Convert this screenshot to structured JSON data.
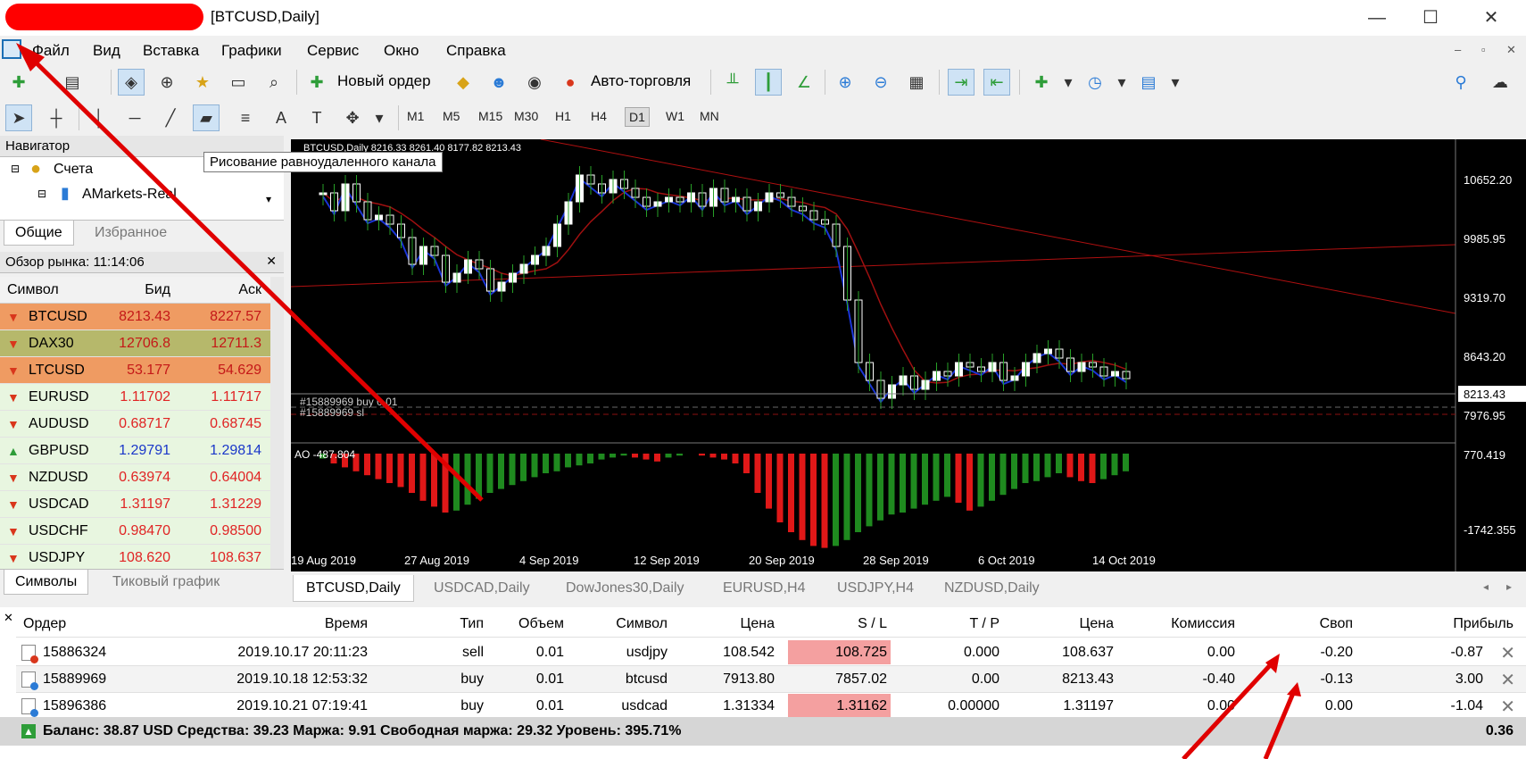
{
  "window": {
    "title": "[BTCUSD,Daily]",
    "minimize_glyph": "—",
    "maximize_glyph": "☐",
    "close_glyph": "✕"
  },
  "menu": {
    "items": [
      "Файл",
      "Вид",
      "Вставка",
      "Графики",
      "Сервис",
      "Окно",
      "Справка"
    ]
  },
  "toolbar": {
    "new_order_label": "Новый ордер",
    "autotrading_label": "Авто-торговля",
    "timeframes": [
      "M1",
      "M5",
      "M15",
      "M30",
      "H1",
      "H4",
      "D1",
      "W1",
      "MN"
    ],
    "active_timeframe": "D1",
    "tooltip": "Рисование равноудаленного канала"
  },
  "navigator": {
    "title": "Навигатор",
    "accounts_label": "Счета",
    "account_name": "AMarkets-Real",
    "tabs": [
      "Общие",
      "Избранное"
    ]
  },
  "market_watch": {
    "title": "Обзор рынка: 11:14:06",
    "columns": [
      "Символ",
      "Бид",
      "Аск"
    ],
    "rows": [
      {
        "symbol": "BTCUSD",
        "bid": "8213.43",
        "ask": "8227.57",
        "dir": "down",
        "color": "#ef9b62"
      },
      {
        "symbol": "DAX30",
        "bid": "12706.8",
        "ask": "12711.3",
        "dir": "down",
        "color": "#b6b86b"
      },
      {
        "symbol": "LTCUSD",
        "bid": "53.177",
        "ask": "54.629",
        "dir": "down",
        "color": "#ef9b62"
      },
      {
        "symbol": "EURUSD",
        "bid": "1.11702",
        "ask": "1.11717",
        "dir": "down",
        "color": "#e8f6e0"
      },
      {
        "symbol": "AUDUSD",
        "bid": "0.68717",
        "ask": "0.68745",
        "dir": "down",
        "color": "#e8f6e0"
      },
      {
        "symbol": "GBPUSD",
        "bid": "1.29791",
        "ask": "1.29814",
        "dir": "up",
        "color": "#e8f6e0"
      },
      {
        "symbol": "NZDUSD",
        "bid": "0.63974",
        "ask": "0.64004",
        "dir": "down",
        "color": "#e8f6e0"
      },
      {
        "symbol": "USDCAD",
        "bid": "1.31197",
        "ask": "1.31229",
        "dir": "down",
        "color": "#e8f6e0"
      },
      {
        "symbol": "USDCHF",
        "bid": "0.98470",
        "ask": "0.98500",
        "dir": "down",
        "color": "#e8f6e0"
      },
      {
        "symbol": "USDJPY",
        "bid": "108.620",
        "ask": "108.637",
        "dir": "down",
        "color": "#e8f6e0"
      }
    ],
    "tabs": [
      "Символы",
      "Тиковый график"
    ]
  },
  "chart": {
    "header": "BTCUSD,Daily  8216.33 8261.40 8177.82 8213.43",
    "price_labels": [
      "10652.20",
      "9985.95",
      "9319.70",
      "8643.20",
      "8213.43",
      "7976.95"
    ],
    "current_price": "8213.43",
    "order_labels": [
      "#15889969 buy 0.01",
      "#15889969 sl"
    ],
    "ao_label": "AO -487.804",
    "ao_labels": [
      "770.419",
      "-1742.355"
    ],
    "date_labels": [
      "19 Aug 2019",
      "27 Aug 2019",
      "4 Sep 2019",
      "12 Sep 2019",
      "20 Sep 2019",
      "28 Sep 2019",
      "6 Oct 2019",
      "14 Oct 2019"
    ]
  },
  "chart_tabs": [
    "BTCUSD,Daily",
    "USDCAD,Daily",
    "DowJones30,Daily",
    "EURUSD,H4",
    "USDJPY,H4",
    "NZDUSD,Daily"
  ],
  "orders": {
    "columns": [
      "Ордер",
      "Время",
      "Тип",
      "Объем",
      "Символ",
      "Цена",
      "S / L",
      "T / P",
      "Цена",
      "Комиссия",
      "Своп",
      "Прибыль"
    ],
    "rows": [
      {
        "order": "15886324",
        "time": "2019.10.17 20:11:23",
        "type": "sell",
        "volume": "0.01",
        "symbol": "usdjpy",
        "price": "108.542",
        "sl": "108.725",
        "tp": "0.000",
        "cur": "108.637",
        "commission": "0.00",
        "swap": "-0.20",
        "profit": "-0.87",
        "sl_highlight": true
      },
      {
        "order": "15889969",
        "time": "2019.10.18 12:53:32",
        "type": "buy",
        "volume": "0.01",
        "symbol": "btcusd",
        "price": "7913.80",
        "sl": "7857.02",
        "tp": "0.00",
        "cur": "8213.43",
        "commission": "-0.40",
        "swap": "-0.13",
        "profit": "3.00",
        "sl_highlight": false
      },
      {
        "order": "15896386",
        "time": "2019.10.21 07:19:41",
        "type": "buy",
        "volume": "0.01",
        "symbol": "usdcad",
        "price": "1.31334",
        "sl": "1.31162",
        "tp": "0.00000",
        "cur": "1.31197",
        "commission": "0.00",
        "swap": "0.00",
        "profit": "-1.04",
        "sl_highlight": true
      }
    ],
    "balance_line": "Баланс: 38.87 USD  Средства: 39.23  Маржа: 9.91  Свободная маржа: 29.32  Уровень: 395.71%",
    "total_profit": "0.36"
  },
  "colors": {
    "bull": "#ffffff",
    "bear": "#ffffff",
    "ma_blue": "#1a35d6",
    "ma_red": "#a01010",
    "ao_up": "#1f8a1f",
    "ao_down": "#e01818",
    "sl_highlight": "#f4a0a0",
    "annotation_red": "#e00000"
  }
}
